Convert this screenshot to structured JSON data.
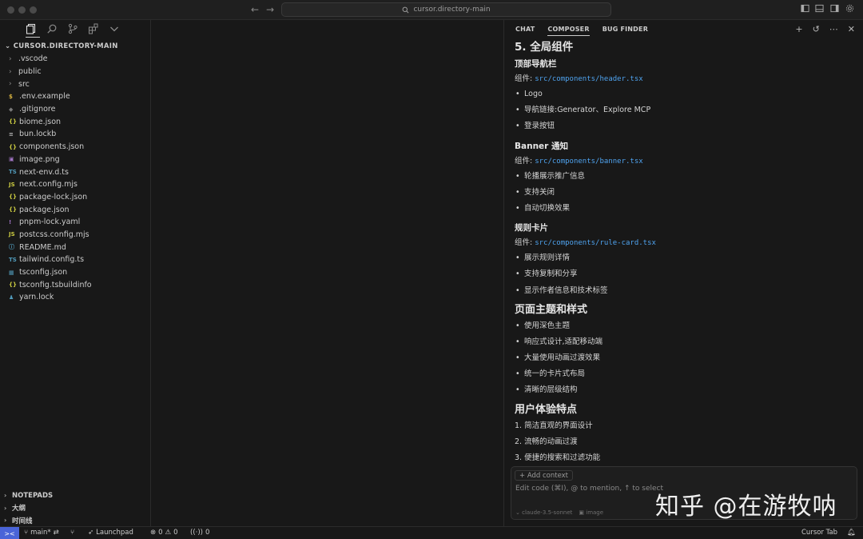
{
  "titlebar": {
    "back": "←",
    "forward": "→",
    "command_center": "cursor.directory-main"
  },
  "explorer": {
    "root_label": "CURSOR.DIRECTORY-MAIN",
    "items": [
      {
        "type": "folder",
        "name": ".vscode",
        "icon": "chevron-right",
        "color": "#cccccc"
      },
      {
        "type": "folder",
        "name": "public",
        "icon": "chevron-right",
        "color": "#cccccc"
      },
      {
        "type": "folder",
        "name": "src",
        "icon": "chevron-right",
        "color": "#cccccc"
      },
      {
        "type": "file",
        "name": ".env.example",
        "icon": "$",
        "color": "#d6b140"
      },
      {
        "type": "file",
        "name": ".gitignore",
        "icon": "◆",
        "color": "#7a7a7a"
      },
      {
        "type": "file",
        "name": "biome.json",
        "icon": "{}",
        "color": "#cbcb41"
      },
      {
        "type": "file",
        "name": "bun.lockb",
        "icon": "≡",
        "color": "#b5b5b5"
      },
      {
        "type": "file",
        "name": "components.json",
        "icon": "{}",
        "color": "#cbcb41"
      },
      {
        "type": "file",
        "name": "image.png",
        "icon": "▣",
        "color": "#a074c4"
      },
      {
        "type": "file",
        "name": "next-env.d.ts",
        "icon": "TS",
        "color": "#519aba"
      },
      {
        "type": "file",
        "name": "next.config.mjs",
        "icon": "JS",
        "color": "#cbcb41"
      },
      {
        "type": "file",
        "name": "package-lock.json",
        "icon": "{}",
        "color": "#cbcb41"
      },
      {
        "type": "file",
        "name": "package.json",
        "icon": "{}",
        "color": "#cbcb41"
      },
      {
        "type": "file",
        "name": "pnpm-lock.yaml",
        "icon": "!",
        "color": "#a074c4"
      },
      {
        "type": "file",
        "name": "postcss.config.mjs",
        "icon": "JS",
        "color": "#cbcb41"
      },
      {
        "type": "file",
        "name": "README.md",
        "icon": "ⓘ",
        "color": "#519aba"
      },
      {
        "type": "file",
        "name": "tailwind.config.ts",
        "icon": "TS",
        "color": "#519aba"
      },
      {
        "type": "file",
        "name": "tsconfig.json",
        "icon": "▦",
        "color": "#519aba"
      },
      {
        "type": "file",
        "name": "tsconfig.tsbuildinfo",
        "icon": "{}",
        "color": "#cbcb41"
      },
      {
        "type": "file",
        "name": "yarn.lock",
        "icon": "♟",
        "color": "#519aba"
      }
    ],
    "sections": [
      "NOTEPADS",
      "大纲",
      "时间线"
    ]
  },
  "panel": {
    "tabs": [
      "CHAT",
      "COMPOSER",
      "BUG FINDER"
    ],
    "active_tab": "COMPOSER",
    "content": {
      "h1": "5. 全局组件",
      "groups": [
        {
          "title": "顶部导航栏",
          "comp_label": "组件:",
          "comp_path": "src/components/header.tsx",
          "bullets": [
            "Logo",
            "导航链接:Generator、Explore MCP",
            "登录按钮"
          ]
        },
        {
          "title": "Banner 通知",
          "comp_label": "组件:",
          "comp_path": "src/components/banner.tsx",
          "bullets": [
            "轮播展示推广信息",
            "支持关闭",
            "自动切换效果"
          ]
        },
        {
          "title": "规则卡片",
          "comp_label": "组件:",
          "comp_path": "src/components/rule-card.tsx",
          "bullets": [
            "展示规则详情",
            "支持复制和分享",
            "显示作者信息和技术标签"
          ]
        }
      ],
      "theme_title": "页面主题和样式",
      "theme_bullets": [
        "使用深色主题",
        "响应式设计,适配移动端",
        "大量使用动画过渡效果",
        "统一的卡片式布局",
        "清晰的层级结构"
      ],
      "ux_title": "用户体验特点",
      "ux_items": [
        "1. 简洁直观的界面设计",
        "2. 流畅的动画过渡",
        "3. 便捷的搜索和过滤功能"
      ]
    }
  },
  "composer": {
    "add_context": "+ Add context",
    "placeholder": "Edit code (⌘I), @ to mention, ↑ to select",
    "model": "claude-3.5-sonnet",
    "image_label": "image"
  },
  "watermark": "知乎 @在游牧呐",
  "statusbar": {
    "remote_icon": "><",
    "branch": "main*",
    "launchpad": "Launchpad",
    "errors": "0",
    "warnings": "0",
    "ports": "0",
    "cursor_tab": "Cursor Tab"
  }
}
